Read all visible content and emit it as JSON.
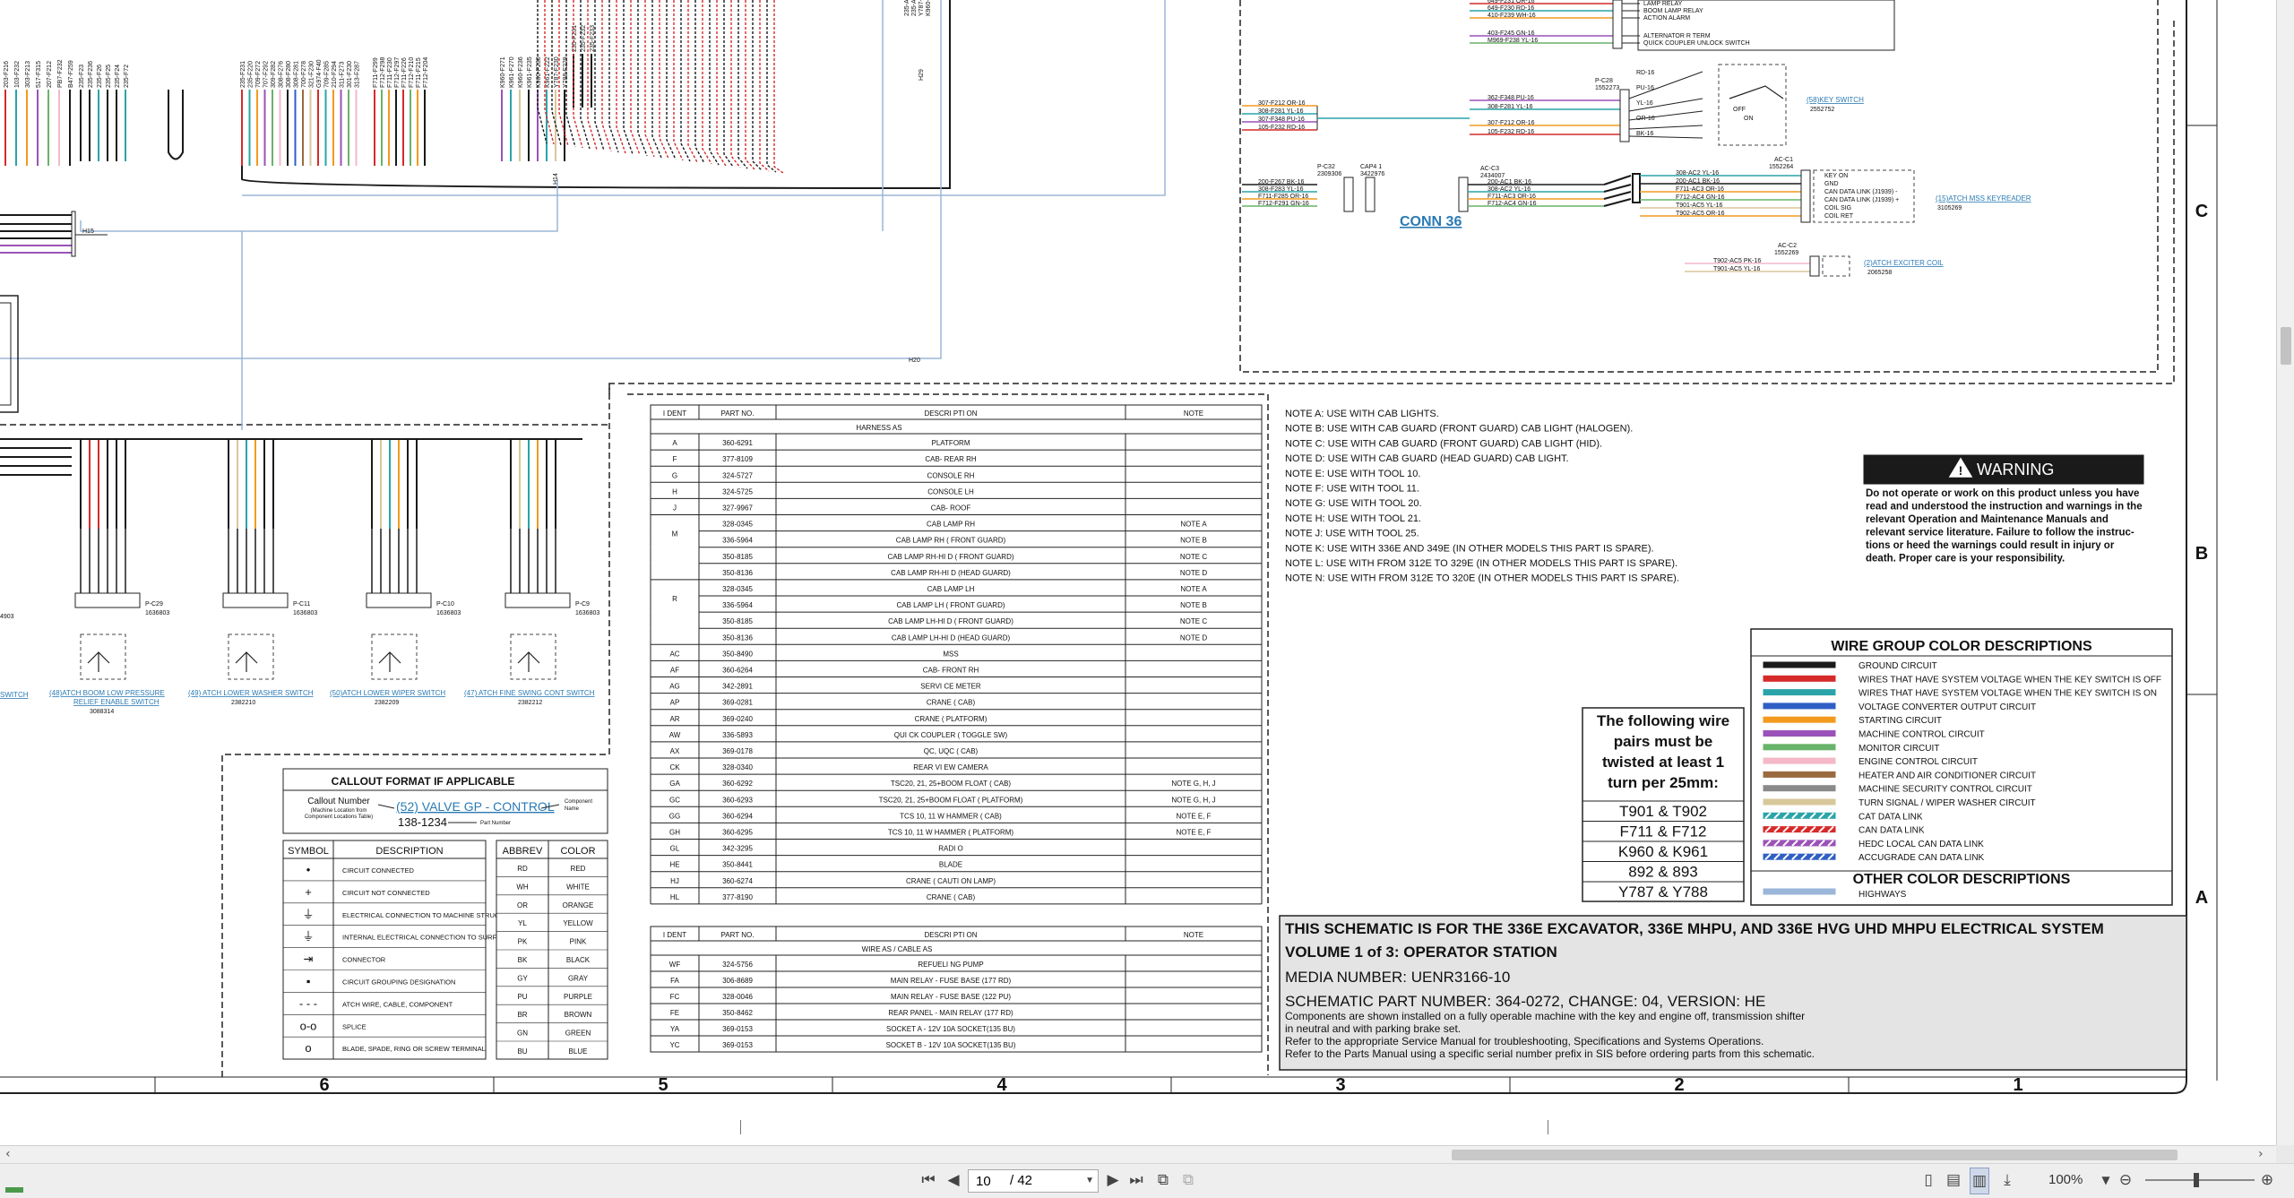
{
  "viewer": {
    "page_current": "10",
    "page_total": "/ 42",
    "zoom": "100%"
  },
  "schematic": {
    "grid_rows": [
      "C",
      "B",
      "A"
    ],
    "grid_cols": [
      "6",
      "5",
      "4",
      "3",
      "2",
      "1"
    ],
    "conn_label": "CONN 36",
    "harness_table": {
      "headers": [
        "I DENT",
        "PART NO.",
        "DESCRI PTI ON",
        "NOTE"
      ],
      "section": "HARNESS AS",
      "rows": [
        [
          "A",
          "360-6291",
          "PLATFORM",
          ""
        ],
        [
          "F",
          "377-8109",
          "CAB- REAR RH",
          ""
        ],
        [
          "G",
          "324-5727",
          "CONSOLE RH",
          ""
        ],
        [
          "H",
          "324-5725",
          "CONSOLE LH",
          ""
        ],
        [
          "J",
          "327-9967",
          "CAB- ROOF",
          ""
        ],
        [
          "",
          "328-0345",
          "CAB LAMP RH",
          "NOTE A"
        ],
        [
          "M",
          "336-5964",
          "CAB LAMP RH ( FRONT GUARD)",
          "NOTE B"
        ],
        [
          "",
          "350-8185",
          "CAB LAMP RH-HI D ( FRONT GUARD)",
          "NOTE C"
        ],
        [
          "",
          "350-8136",
          "CAB LAMP RH-HI D (HEAD GUARD)",
          "NOTE D"
        ],
        [
          "",
          "328-0345",
          "CAB LAMP LH",
          "NOTE A"
        ],
        [
          "R",
          "336-5964",
          "CAB LAMP LH ( FRONT GUARD)",
          "NOTE B"
        ],
        [
          "",
          "350-8185",
          "CAB LAMP LH-HI D ( FRONT GUARD)",
          "NOTE C"
        ],
        [
          "",
          "350-8136",
          "CAB LAMP LH-HI D (HEAD GUARD)",
          "NOTE D"
        ],
        [
          "AC",
          "350-8490",
          "MSS",
          ""
        ],
        [
          "AF",
          "360-6264",
          "CAB- FRONT RH",
          ""
        ],
        [
          "AG",
          "342-2891",
          "SERVI CE METER",
          ""
        ],
        [
          "AP",
          "369-0281",
          "CRANE ( CAB)",
          ""
        ],
        [
          "AR",
          "369-0240",
          "CRANE ( PLATFORM)",
          ""
        ],
        [
          "AW",
          "336-5893",
          "QUI CK COUPLER ( TOGGLE SW)",
          ""
        ],
        [
          "AX",
          "369-0178",
          "QC, UQC ( CAB)",
          ""
        ],
        [
          "CK",
          "328-0340",
          "REAR VI EW CAMERA",
          ""
        ],
        [
          "GA",
          "360-6292",
          "TSC20, 21, 25+BOOM FLOAT ( CAB)",
          "NOTE G, H, J"
        ],
        [
          "GC",
          "360-6293",
          "TSC20, 21, 25+BOOM FLOAT ( PLATFORM)",
          "NOTE G, H, J"
        ],
        [
          "GG",
          "360-6294",
          "TCS 10, 11 W HAMMER ( CAB)",
          "NOTE E, F"
        ],
        [
          "GH",
          "360-6295",
          "TCS 10, 11 W HAMMER ( PLATFORM)",
          "NOTE E, F"
        ],
        [
          "GL",
          "342-3295",
          "RADI O",
          ""
        ],
        [
          "HE",
          "350-8441",
          "BLADE",
          ""
        ],
        [
          "HJ",
          "360-6274",
          "CRANE ( CAUTI ON LAMP)",
          ""
        ],
        [
          "HL",
          "377-8190",
          "CRANE ( CAB)",
          ""
        ]
      ]
    },
    "wire_table": {
      "headers": [
        "I DENT",
        "PART NO.",
        "DESCRI PTI ON",
        "NOTE"
      ],
      "section": "WIRE AS / CABLE AS",
      "rows": [
        [
          "WF",
          "324-5756",
          "REFUELI NG PUMP",
          ""
        ],
        [
          "FA",
          "306-8689",
          "MAIN RELAY - FUSE BASE (177 RD)",
          ""
        ],
        [
          "FC",
          "328-0046",
          "MAIN RELAY - FUSE BASE (122 PU)",
          ""
        ],
        [
          "FE",
          "350-8462",
          "REAR PANEL - MAIN RELAY (177 RD)",
          ""
        ],
        [
          "YA",
          "369-0153",
          "SOCKET A - 12V 10A SOCKET(135 BU)",
          ""
        ],
        [
          "YC",
          "369-0153",
          "SOCKET B - 12V 10A SOCKET(135 BU)",
          ""
        ]
      ]
    },
    "notes": [
      "NOTE A: USE WITH CAB LIGHTS.",
      "NOTE B: USE WITH CAB GUARD (FRONT GUARD) CAB LIGHT (HALOGEN).",
      "NOTE C: USE WITH CAB GUARD (FRONT GUARD) CAB LIGHT (HID).",
      "NOTE D: USE WITH CAB GUARD (HEAD GUARD) CAB LIGHT.",
      "NOTE E: USE WITH TOOL 10.",
      "NOTE F: USE WITH TOOL 11.",
      "NOTE G: USE WITH TOOL 20.",
      "NOTE H: USE WITH TOOL 21.",
      "NOTE J: USE WITH TOOL 25.",
      "NOTE K: USE WITH 336E AND 349E (IN OTHER MODELS THIS PART IS SPARE).",
      "NOTE L: USE WITH FROM 312E TO 329E (IN OTHER MODELS THIS PART IS SPARE).",
      "NOTE N: USE WITH FROM 312E TO 320E (IN OTHER MODELS THIS PART IS SPARE)."
    ],
    "warning": {
      "title": "WARNING",
      "lines": [
        "Do not operate or work on this product unless you have",
        "read and understood the instruction and warnings in the",
        "relevant Operation and Maintenance Manuals and",
        "relevant service literature. Failure to follow the instruc-",
        "tions or heed the warnings could result in injury or",
        "death. Proper care is your responsibility."
      ]
    },
    "wire_colors": {
      "title": "WIRE GROUP COLOR DESCRIPTIONS",
      "items": [
        {
          "label": "GROUND CIRCUIT",
          "color": "#1a1a1a",
          "hatch": false
        },
        {
          "label": "WIRES THAT HAVE SYSTEM VOLTAGE WHEN THE KEY SWITCH IS OFF",
          "color": "#d62a2a",
          "hatch": false
        },
        {
          "label": "WIRES THAT HAVE SYSTEM VOLTAGE WHEN THE KEY SWITCH IS ON",
          "color": "#2aa4a8",
          "hatch": false
        },
        {
          "label": "VOLTAGE CONVERTER OUTPUT CIRCUIT",
          "color": "#2f5fc4",
          "hatch": false
        },
        {
          "label": "STARTING CIRCUIT",
          "color": "#f39a1e",
          "hatch": false
        },
        {
          "label": "MACHINE CONTROL CIRCUIT",
          "color": "#9a52b8",
          "hatch": false
        },
        {
          "label": "MONITOR CIRCUIT",
          "color": "#68b36a",
          "hatch": false
        },
        {
          "label": "ENGINE CONTROL CIRCUIT",
          "color": "#f4b8c8",
          "hatch": false
        },
        {
          "label": "HEATER AND AIR CONDITIONER CIRCUIT",
          "color": "#9a6b3f",
          "hatch": false
        },
        {
          "label": "MACHINE SECURITY CONTROL CIRCUIT",
          "color": "#8a8a8a",
          "hatch": false
        },
        {
          "label": "TURN SIGNAL / WIPER WASHER CIRCUIT",
          "color": "#d8c79a",
          "hatch": false
        },
        {
          "label": "CAT DATA LINK",
          "color": "#2aa4a8",
          "hatch": true
        },
        {
          "label": "CAN DATA LINK",
          "color": "#d62a2a",
          "hatch": true
        },
        {
          "label": "HEDC LOCAL CAN DATA LINK",
          "color": "#9a52b8",
          "hatch": true
        },
        {
          "label": "ACCUGRADE CAN DATA LINK",
          "color": "#2f5fc4",
          "hatch": true
        }
      ],
      "other_title": "OTHER COLOR DESCRIPTIONS",
      "other_items": [
        {
          "label": "HIGHWAYS",
          "color": "#9bb6d8"
        }
      ]
    },
    "twisted": {
      "heading": [
        "The following wire",
        "pairs must be",
        "twisted at least 1",
        "turn per 25mm:"
      ],
      "pairs": [
        "T901  &  T902",
        "F711  &  F712",
        "K960  &  K961",
        "892  &  893",
        "Y787  &  Y788"
      ]
    },
    "title_block": {
      "line1": "THIS SCHEMATIC IS FOR THE 336E EXCAVATOR, 336E MHPU, AND 336E HVG UHD MHPU ELECTRICAL SYSTEM",
      "line2": "VOLUME 1 of 3: OPERATOR STATION",
      "line3": "MEDIA NUMBER: UENR3166-10",
      "line4": "SCHEMATIC PART NUMBER: 364-0272, CHANGE: 04, VERSION: HE",
      "body": [
        "Components are shown installed on a fully operable machine with the key and engine off, transmission shifter",
        "in neutral and with parking brake set.",
        "Refer to the appropriate Service Manual for troubleshooting, Specifications and Systems Operations.",
        "Refer to the Parts Manual using a specific serial number prefix in SIS before ordering parts from this schematic."
      ]
    },
    "callout": {
      "title": "CALLOUT FORMAT IF APPLICABLE",
      "label_lines": [
        "Callout Number",
        "(Machine Location from",
        "Component Locations Table)"
      ],
      "link": "(52) VALVE GP - CONTROL",
      "part": "138-1234",
      "right_label": [
        "Component",
        "Name"
      ],
      "part_label": "Part Number"
    },
    "symbols": {
      "headers": [
        "SYMBOL",
        "DESCRIPTION"
      ],
      "rows": [
        {
          "icon": "•",
          "desc": "CIRCUIT CONNECTED"
        },
        {
          "icon": "+",
          "desc": "CIRCUIT NOT CONNECTED"
        },
        {
          "icon": "⏚",
          "desc": "ELECTRICAL CONNECTION TO MACHINE STRUCTURE"
        },
        {
          "icon": "⏚",
          "desc": "INTERNAL ELECTRICAL CONNECTION TO SURFACE OF COMPONENT"
        },
        {
          "icon": "⇥",
          "desc": "CONNECTOR"
        },
        {
          "icon": "▪",
          "desc": "CIRCUIT GROUPING DESIGNATION"
        },
        {
          "icon": "- - -",
          "desc": "ATCH WIRE, CABLE, COMPONENT"
        },
        {
          "icon": "o-o",
          "desc": "SPLICE"
        },
        {
          "icon": "o",
          "desc": "BLADE, SPADE, RING OR SCREW TERMINAL"
        }
      ]
    },
    "colors_abbrev": {
      "headers": [
        "ABBREV",
        "COLOR"
      ],
      "rows": [
        [
          "RD",
          "RED"
        ],
        [
          "WH",
          "WHITE"
        ],
        [
          "OR",
          "ORANGE"
        ],
        [
          "YL",
          "YELLOW"
        ],
        [
          "PK",
          "PINK"
        ],
        [
          "BK",
          "BLACK"
        ],
        [
          "GY",
          "GRAY"
        ],
        [
          "PU",
          "PURPLE"
        ],
        [
          "BR",
          "BROWN"
        ],
        [
          "GN",
          "GREEN"
        ],
        [
          "BU",
          "BLUE"
        ]
      ]
    },
    "connectors": {
      "c29": [
        "P-C29",
        "1636803"
      ],
      "c11": [
        "P-C11",
        "1636803"
      ],
      "c10": [
        "P-C10",
        "1636803"
      ],
      "c9": [
        "P-C9",
        "1636803"
      ],
      "c28": [
        "P-C28",
        "1552273"
      ],
      "c32": [
        "P-C32",
        "2309306"
      ],
      "cap4": [
        "CAP4 1",
        "3422976"
      ],
      "ac03": [
        "AC-C3",
        "2434007"
      ],
      "ac01": [
        "AC-C1",
        "1552264"
      ],
      "ac02": [
        "AC-C2",
        "1552269"
      ]
    },
    "switch_labels": {
      "boom": [
        "(48)ATCH BOOM LOW PRESSURE",
        "RELIEF ENABLE SWITCH",
        "3088314"
      ],
      "lower": [
        "(49) ATCH LOWER WASHER SWITCH",
        "2382210"
      ],
      "wiper": [
        "(50)ATCH LOWER WIPER SWITCH",
        "2382209"
      ],
      "cont": [
        "(47) ATCH FINE SWING CONT SWITCH",
        "2382212"
      ],
      "left_switch": "SWITCH",
      "left_num": "4903",
      "key": [
        "(58)KEY SWITCH",
        "2552752"
      ],
      "reader": [
        "(15)ATCH MSS KEYREADER",
        "3105269"
      ],
      "exciter": [
        "(2)ATCH EXCITER COIL",
        "2065258"
      ]
    },
    "key_switch_pins": [
      "RD-16",
      "PU-16",
      "YL-16",
      "OR-16",
      "BK-16"
    ],
    "key_switch_states": [
      "OFF",
      "ON"
    ],
    "reader_pins": [
      "KEY ON",
      "GND",
      "CAN DATA LINK (J1939) -",
      "CAN DATA LINK (J1939) +",
      "COIL SIG",
      "COIL RET"
    ],
    "relay_labels": [
      "LAMP RELAY",
      "BOOM LAMP RELAY",
      "ACTION ALARM",
      "ALTERNATOR R TERM",
      "QUICK COUPLER UNLOCK SWITCH"
    ],
    "top_wires": {
      "left": [
        "203-F216",
        "103-F232",
        "303-F213",
        "517-F315",
        "207-F212",
        "PB7-F232",
        "B47-F259"
      ],
      "mid": [
        "235-F23",
        "235-F236",
        "235-F26",
        "235-F25",
        "235-F24",
        "235-F72"
      ],
      "big": [
        "235-F231",
        "235-F220",
        "709-F272",
        "707-F292",
        "309-F282",
        "308-F276",
        "308-F280",
        "308-F281",
        "700-F278",
        "321-F230",
        "G974-F40",
        "709-F285",
        "210-F294",
        "311-F273",
        "301-F230",
        "313-F287"
      ],
      "f7": [
        "F711-F299",
        "F712-F298",
        "F711-F230",
        "F712-F297",
        "F711-F226",
        "F712-F210",
        "F711-F215",
        "F712-F204"
      ],
      "right": [
        "K960-F271",
        "K961-F270",
        "K960-F236",
        "K961-F235",
        "K960-F230",
        "K961-F222",
        "Y787-F230",
        "Y788-F229"
      ],
      "far": [
        "235-F231",
        "235-F232",
        "235-F233"
      ],
      "vert": [
        "235-AX3 BK-16",
        "235-AX1 PU-16",
        "Y787-AX1 RD-16",
        "K960-AX2 YL-16"
      ]
    },
    "mid_wires": {
      "w1": [
        "307-F212 OR-16",
        "308-F281 YL-16",
        "307-F348 PU-16",
        "105-F232 RD-16"
      ],
      "w2": [
        "362-F348 PU-16",
        "308-F281 YL-16",
        "307-F212 OR-16",
        "105-F232 RD-16"
      ],
      "w3": [
        "200-F267 BK-16",
        "308-F283 YL-16",
        "F711-F285 OR-16",
        "F712-F291 GN-16"
      ],
      "w4": [
        "200-AC1 BK-16",
        "308-AC2 YL-16",
        "F711-AC3 OR-16",
        "F712-AC4 GN-16"
      ],
      "w5": [
        "308-AC2 YL-16",
        "200-AC1 BK-16",
        "F711-AC3 OR-16",
        "F712-AC4 GN-16",
        "T901-AC5 YL-16",
        "T902-AC5 OR-16"
      ],
      "w6": [
        "T902-AC5 PK-16",
        "T901-AC5 YL-16"
      ],
      "top_right": [
        "649-F231 OR-16",
        "649-F230 RD-16",
        "410-F239 WH-16",
        "403-F245 GN-16",
        "M969-F238 YL-16"
      ]
    },
    "misc": {
      "h15": "H15",
      "h14": "H14",
      "h20": "H20",
      "h29": "H29"
    }
  }
}
